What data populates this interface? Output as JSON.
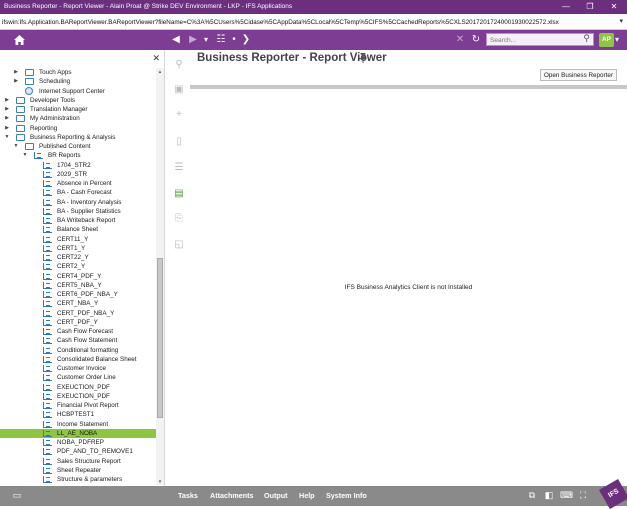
{
  "window": {
    "title": "Business Reporter - Report Viewer - Alain Proat @ Strike DEV Environment - LKP - IFS Applications",
    "minimize": "—",
    "restore": "❐",
    "close": "✕"
  },
  "address": {
    "url": "ifswin:Ifs.Application.BAReportViewer.BAReportViewer?fileName=C%3A%5CUsers%5Cidase%5CAppData%5CLocal%5CTemp%5CIFS%5CCachedReports%5CXLS20172017240001930022572.xlsx"
  },
  "toolbar": {
    "home_icon": "home-icon",
    "back_icon": "◀",
    "forward_icon": "▶",
    "dropdown_icon": "▾",
    "apps_icon": "☷",
    "more_icon": "•",
    "chevron_icon": "❯",
    "clear_icon": "✕",
    "refresh_icon": "↻",
    "search_placeholder": "Search...",
    "search_icon": "⚲",
    "avatar_initials": "AP",
    "avatar_menu": "▾"
  },
  "nav": {
    "close": "✕",
    "items": [
      {
        "label": "Touch Apps",
        "level": 1,
        "icon": "folder",
        "arrow": "▶"
      },
      {
        "label": "Scheduling",
        "level": 1,
        "icon": "folder",
        "arrow": "▶"
      },
      {
        "label": "Internet Support Center",
        "level": 1,
        "icon": "globe",
        "arrow": ""
      },
      {
        "label": "Developer Tools",
        "level": 0,
        "icon": "folder",
        "arrow": "▶"
      },
      {
        "label": "Translation Manager",
        "level": 0,
        "icon": "folder",
        "arrow": "▶"
      },
      {
        "label": "My Administration",
        "level": 0,
        "icon": "folder",
        "arrow": "▶"
      },
      {
        "label": "Reporting",
        "level": 0,
        "icon": "folder",
        "arrow": "▶"
      },
      {
        "label": "Business Reporting & Analysis",
        "level": 0,
        "icon": "folder",
        "arrow": "▼"
      },
      {
        "label": "Published Content",
        "level": 1,
        "icon": "folder",
        "arrow": "▼"
      },
      {
        "label": "BR Reports",
        "level": 2,
        "icon": "report",
        "arrow": "▼"
      },
      {
        "label": "1704_STR2",
        "level": 3,
        "icon": "report",
        "arrow": ""
      },
      {
        "label": "2029_STR",
        "level": 3,
        "icon": "report",
        "arrow": ""
      },
      {
        "label": "Absence in Percent",
        "level": 3,
        "icon": "report",
        "arrow": ""
      },
      {
        "label": "BA - Cash Forecast",
        "level": 3,
        "icon": "report",
        "arrow": ""
      },
      {
        "label": "BA - Inventory Analysis",
        "level": 3,
        "icon": "report",
        "arrow": ""
      },
      {
        "label": "BA - Supplier Statistics",
        "level": 3,
        "icon": "report",
        "arrow": ""
      },
      {
        "label": "BA Writeback Report",
        "level": 3,
        "icon": "report",
        "arrow": ""
      },
      {
        "label": "Balance Sheet",
        "level": 3,
        "icon": "report",
        "arrow": ""
      },
      {
        "label": "CERT11_Y",
        "level": 3,
        "icon": "report",
        "arrow": ""
      },
      {
        "label": "CERT1_Y",
        "level": 3,
        "icon": "report",
        "arrow": ""
      },
      {
        "label": "CERT22_Y",
        "level": 3,
        "icon": "report",
        "arrow": ""
      },
      {
        "label": "CERT2_Y",
        "level": 3,
        "icon": "report",
        "arrow": ""
      },
      {
        "label": "CERT4_PDF_Y",
        "level": 3,
        "icon": "report",
        "arrow": ""
      },
      {
        "label": "CERT5_NBA_Y",
        "level": 3,
        "icon": "report",
        "arrow": ""
      },
      {
        "label": "CERT6_PDF_NBA_Y",
        "level": 3,
        "icon": "report",
        "arrow": ""
      },
      {
        "label": "CERT_NBA_Y",
        "level": 3,
        "icon": "report",
        "arrow": ""
      },
      {
        "label": "CERT_PDF_NBA_Y",
        "level": 3,
        "icon": "report",
        "arrow": ""
      },
      {
        "label": "CERT_PDF_Y",
        "level": 3,
        "icon": "report",
        "arrow": ""
      },
      {
        "label": "Cash Flow Forecast",
        "level": 3,
        "icon": "report",
        "arrow": ""
      },
      {
        "label": "Cash Flow Statement",
        "level": 3,
        "icon": "report",
        "arrow": ""
      },
      {
        "label": "Conditional formatting",
        "level": 3,
        "icon": "report",
        "arrow": ""
      },
      {
        "label": "Consolidated Balance Sheet",
        "level": 3,
        "icon": "report",
        "arrow": ""
      },
      {
        "label": "Customer Invoice",
        "level": 3,
        "icon": "report",
        "arrow": ""
      },
      {
        "label": "Customer Order Line",
        "level": 3,
        "icon": "report",
        "arrow": ""
      },
      {
        "label": "EXEUCTION_PDF",
        "level": 3,
        "icon": "report",
        "arrow": ""
      },
      {
        "label": "EXEUCTION_PDF",
        "level": 3,
        "icon": "report",
        "arrow": ""
      },
      {
        "label": "Financial Pivot Report",
        "level": 3,
        "icon": "report",
        "arrow": ""
      },
      {
        "label": "HCBPTEST1",
        "level": 3,
        "icon": "report",
        "arrow": ""
      },
      {
        "label": "Income Statement",
        "level": 3,
        "icon": "report",
        "arrow": ""
      },
      {
        "label": "LL_AE_NOBA",
        "level": 3,
        "icon": "report",
        "arrow": "",
        "selected": true
      },
      {
        "label": "NOBA_PDFREP",
        "level": 3,
        "icon": "report",
        "arrow": ""
      },
      {
        "label": "PDF_AND_TO_REMOVE1",
        "level": 3,
        "icon": "report",
        "arrow": ""
      },
      {
        "label": "Sales Structure Report",
        "level": 3,
        "icon": "report",
        "arrow": ""
      },
      {
        "label": "Sheet Repeater",
        "level": 3,
        "icon": "report",
        "arrow": ""
      },
      {
        "label": "Structure & parameters",
        "level": 3,
        "icon": "report",
        "arrow": ""
      }
    ]
  },
  "main": {
    "title": "Business Reporter - Report Viewer",
    "pin_icon": "📌",
    "open_button": "Open Business Reporter",
    "notice": "IFS Business Analytics Client is not Installed"
  },
  "footer": {
    "items": [
      "Tasks",
      "Attachments",
      "Output",
      "Help",
      "System Info"
    ],
    "logo": "IFS"
  },
  "colors": {
    "brand": "#6b2f7e",
    "toolbar": "#7d3d92",
    "selection": "#8dc63f",
    "footer": "#8a8a8a"
  }
}
